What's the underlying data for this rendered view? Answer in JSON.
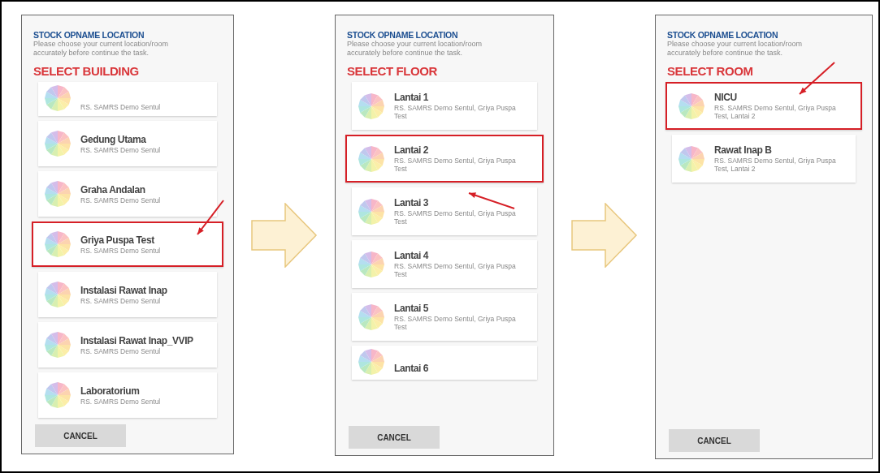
{
  "screens": [
    {
      "title": "STOCK OPNAME LOCATION",
      "description": "Please choose your current location/room accurately before continue the task.",
      "heading": "SELECT BUILDING",
      "items": [
        {
          "kind": "cut",
          "subtitle": "RS. SAMRS Demo Sentul",
          "selected": false
        },
        {
          "kind": "full",
          "name": "Gedung Utama",
          "subtitle": "RS. SAMRS Demo Sentul",
          "selected": false
        },
        {
          "kind": "full",
          "name": "Graha Andalan",
          "subtitle": "RS. SAMRS Demo Sentul",
          "selected": false
        },
        {
          "kind": "full",
          "name": "Griya Puspa Test",
          "subtitle": "RS. SAMRS Demo Sentul",
          "selected": true
        },
        {
          "kind": "full",
          "name": "Instalasi Rawat Inap",
          "subtitle": "RS. SAMRS Demo Sentul",
          "selected": false
        },
        {
          "kind": "full",
          "name": "Instalasi Rawat Inap_VVIP",
          "subtitle": "RS. SAMRS Demo Sentul",
          "selected": false
        },
        {
          "kind": "full",
          "name": "Laboratorium",
          "subtitle": "RS. SAMRS Demo Sentul",
          "selected": false
        }
      ],
      "cancel": "CANCEL"
    },
    {
      "title": "STOCK OPNAME LOCATION",
      "description": "Please choose your current location/room accurately before continue the task.",
      "heading": "SELECT FLOOR",
      "items": [
        {
          "kind": "full",
          "name": "Lantai 1",
          "subtitle": "RS. SAMRS Demo Sentul, Griya Puspa Test",
          "selected": false
        },
        {
          "kind": "full",
          "name": "Lantai 2",
          "subtitle": "RS. SAMRS Demo Sentul, Griya Puspa Test",
          "selected": true
        },
        {
          "kind": "full",
          "name": "Lantai 3",
          "subtitle": "RS. SAMRS Demo Sentul, Griya Puspa Test",
          "selected": false
        },
        {
          "kind": "full",
          "name": "Lantai 4",
          "subtitle": "RS. SAMRS Demo Sentul, Griya Puspa Test",
          "selected": false
        },
        {
          "kind": "full",
          "name": "Lantai 5",
          "subtitle": "RS. SAMRS Demo Sentul, Griya Puspa Test",
          "selected": false
        },
        {
          "kind": "cut",
          "name": "Lantai 6",
          "selected": false
        }
      ],
      "cancel": "CANCEL"
    },
    {
      "title": "STOCK OPNAME LOCATION",
      "description": "Please choose your current location/room accurately before continue the task.",
      "heading": "SELECT ROOM",
      "items": [
        {
          "kind": "full",
          "name": "NICU",
          "subtitle": "RS. SAMRS Demo Sentul, Griya Puspa Test, Lantai 2",
          "selected": true
        },
        {
          "kind": "full",
          "name": "Rawat Inap B",
          "subtitle": "RS. SAMRS Demo Sentul, Griya Puspa Test, Lantai 2",
          "selected": false
        }
      ],
      "cancel": "CANCEL"
    }
  ]
}
